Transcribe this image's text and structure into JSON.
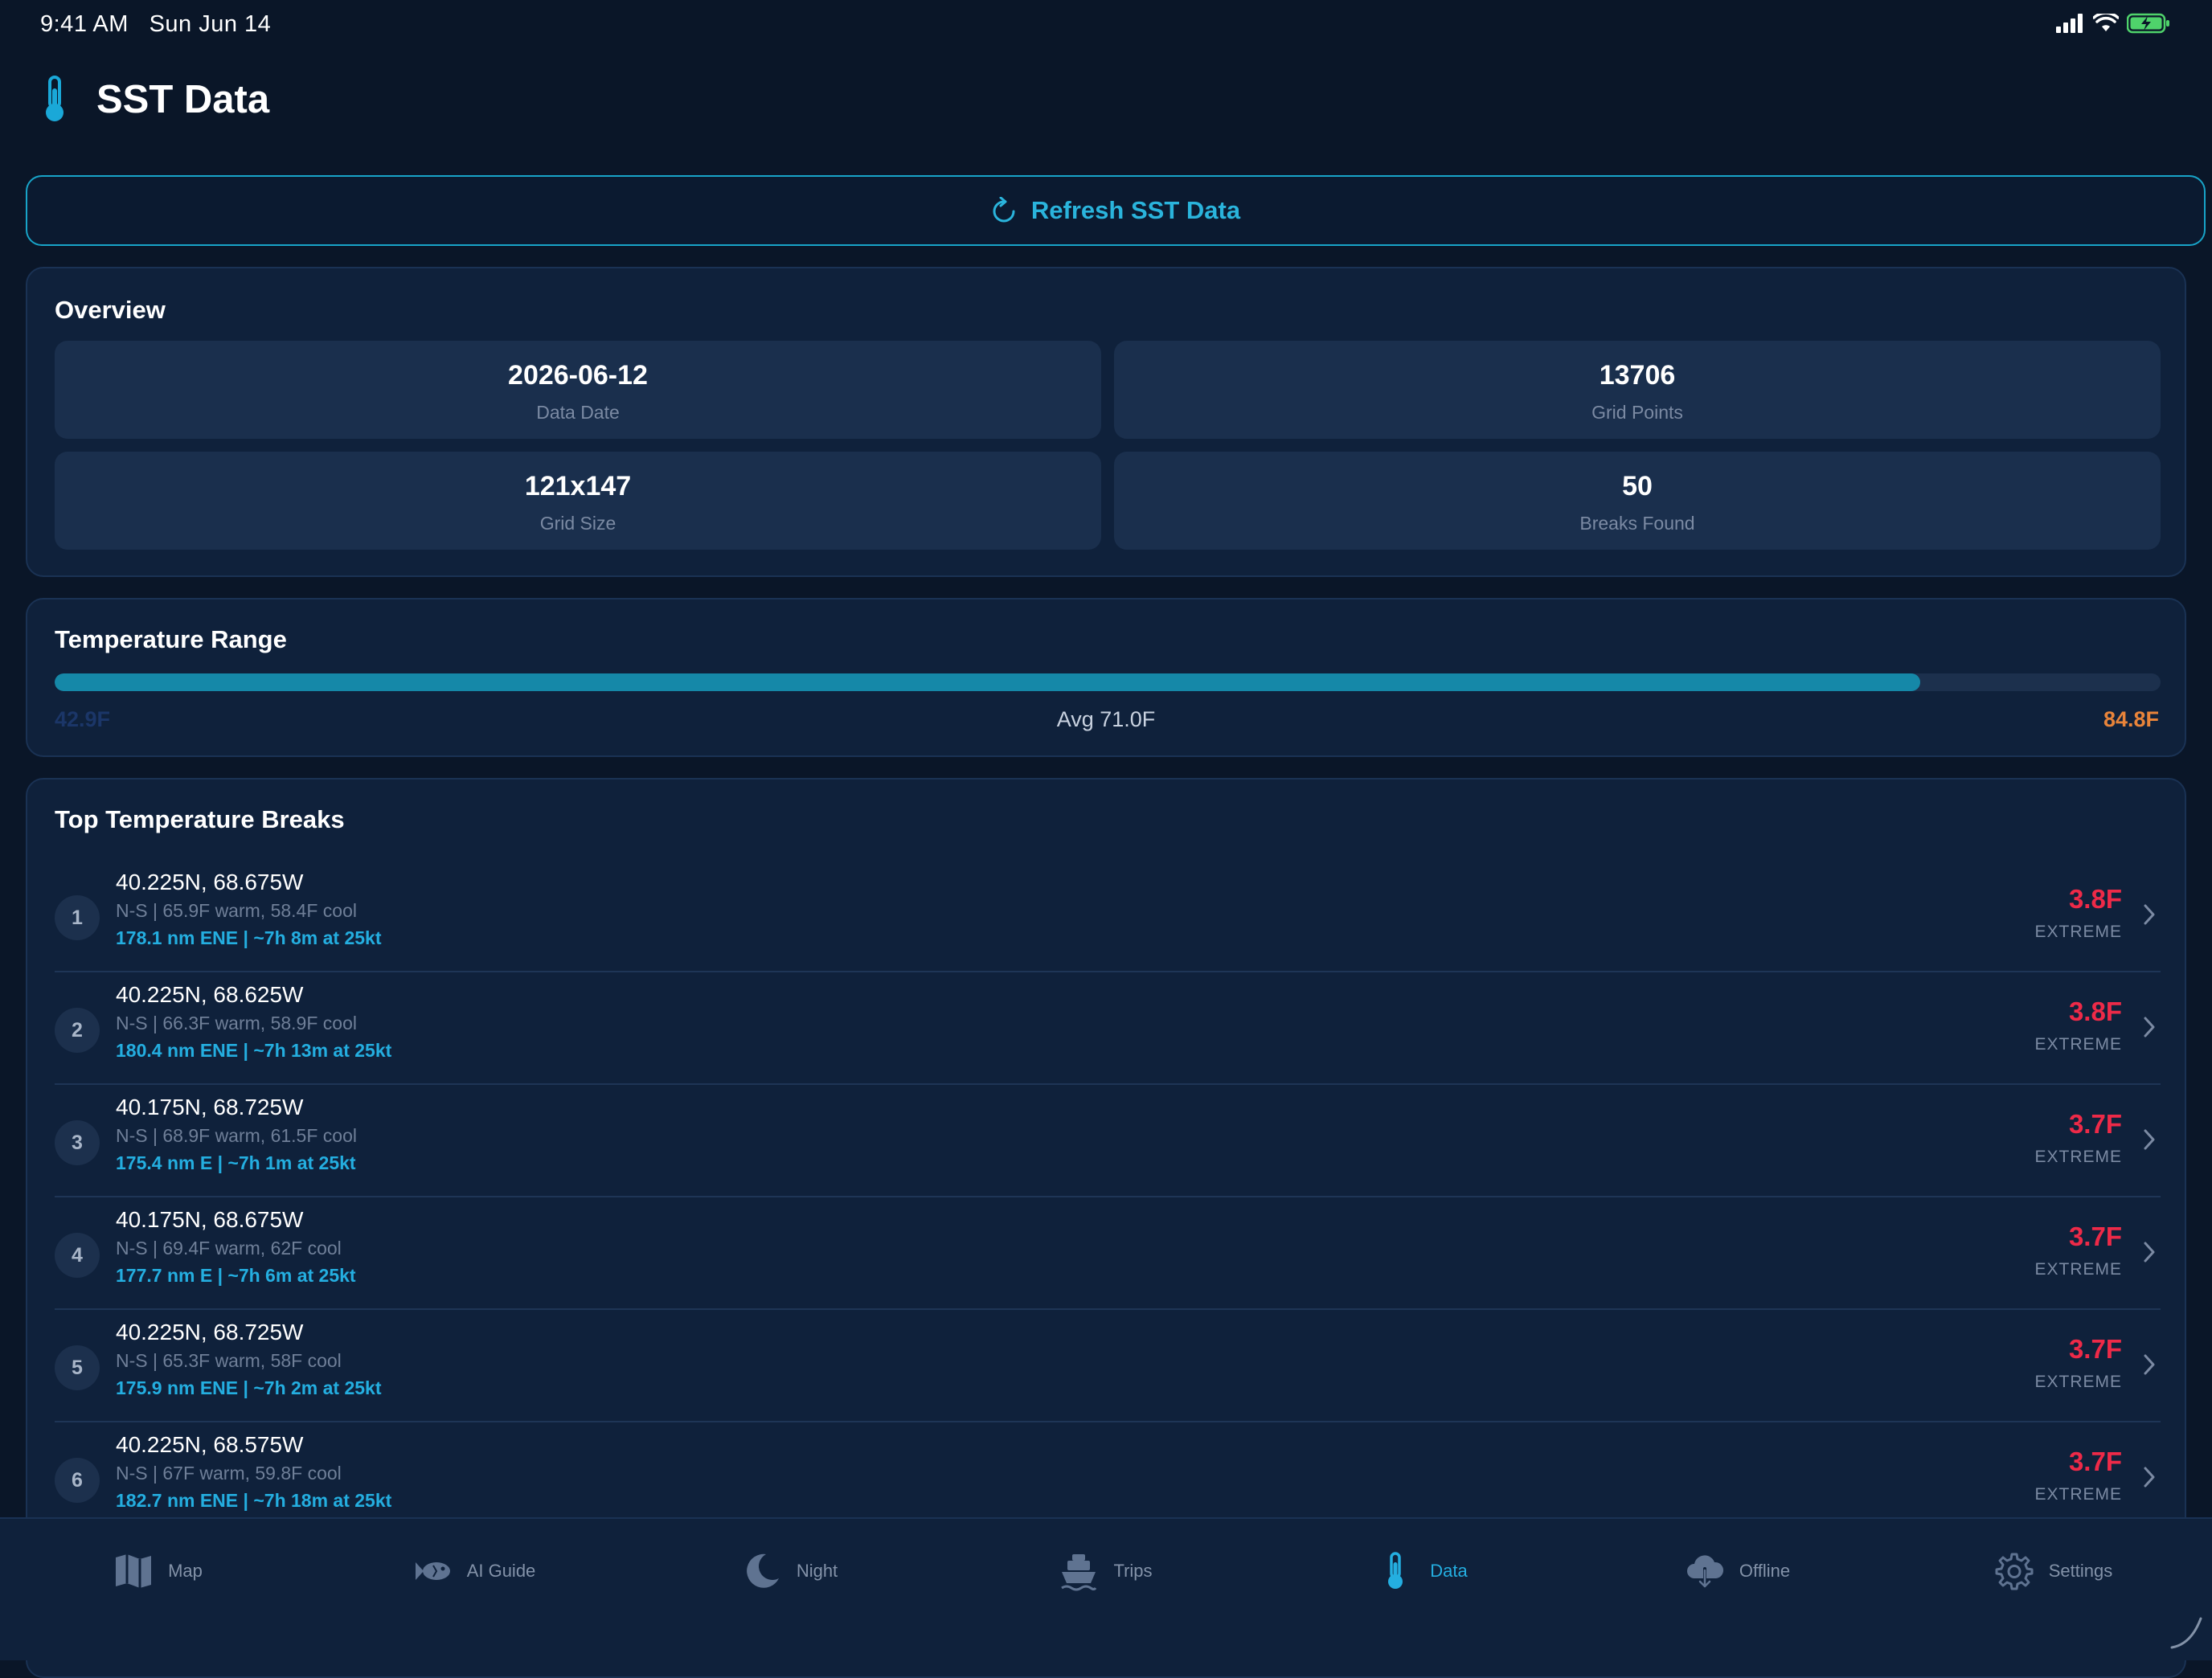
{
  "status_bar": {
    "time": "9:41 AM",
    "date": "Sun Jun 14",
    "icons": [
      "cellular-icon",
      "wifi-icon",
      "battery-charging-icon"
    ]
  },
  "header": {
    "title": "SST Data",
    "icon": "thermometer-icon"
  },
  "refresh": {
    "label": "Refresh SST Data",
    "icon": "refresh-icon"
  },
  "overview": {
    "title": "Overview",
    "stats": [
      {
        "value": "2026-06-12",
        "label": "Data Date"
      },
      {
        "value": "13706",
        "label": "Grid Points"
      },
      {
        "value": "121x147",
        "label": "Grid Size"
      },
      {
        "value": "50",
        "label": "Breaks Found"
      }
    ]
  },
  "temperature_range": {
    "title": "Temperature Range",
    "min_label": "42.9F",
    "avg_label": "Avg 71.0F",
    "max_label": "84.8F",
    "fill_fraction": 0.886
  },
  "breaks": {
    "title": "Top Temperature Breaks",
    "items": [
      {
        "rank": "1",
        "coords": "40.225N, 68.675W",
        "detail": "N-S | 65.9F warm, 58.4F cool",
        "eta": "178.1 nm ENE | ~7h 8m at 25kt",
        "delta": "3.8F",
        "severity": "EXTREME"
      },
      {
        "rank": "2",
        "coords": "40.225N, 68.625W",
        "detail": "N-S | 66.3F warm, 58.9F cool",
        "eta": "180.4 nm ENE | ~7h 13m at 25kt",
        "delta": "3.8F",
        "severity": "EXTREME"
      },
      {
        "rank": "3",
        "coords": "40.175N, 68.725W",
        "detail": "N-S | 68.9F warm, 61.5F cool",
        "eta": "175.4 nm E | ~7h 1m at 25kt",
        "delta": "3.7F",
        "severity": "EXTREME"
      },
      {
        "rank": "4",
        "coords": "40.175N, 68.675W",
        "detail": "N-S | 69.4F warm, 62F cool",
        "eta": "177.7 nm E | ~7h 6m at 25kt",
        "delta": "3.7F",
        "severity": "EXTREME"
      },
      {
        "rank": "5",
        "coords": "40.225N, 68.725W",
        "detail": "N-S | 65.3F warm, 58F cool",
        "eta": "175.9 nm ENE | ~7h 2m at 25kt",
        "delta": "3.7F",
        "severity": "EXTREME"
      },
      {
        "rank": "6",
        "coords": "40.225N, 68.575W",
        "detail": "N-S | 67F warm, 59.8F cool",
        "eta": "182.7 nm ENE | ~7h 18m at 25kt",
        "delta": "3.7F",
        "severity": "EXTREME"
      }
    ]
  },
  "tab_bar": {
    "tabs": [
      {
        "label": "Map",
        "icon": "map-icon",
        "active": false
      },
      {
        "label": "AI Guide",
        "icon": "fish-icon",
        "active": false
      },
      {
        "label": "Night",
        "icon": "moon-icon",
        "active": false
      },
      {
        "label": "Trips",
        "icon": "boat-icon",
        "active": false
      },
      {
        "label": "Data",
        "icon": "thermometer-icon",
        "active": true
      },
      {
        "label": "Offline",
        "icon": "cloud-download-icon",
        "active": false
      },
      {
        "label": "Settings",
        "icon": "gear-icon",
        "active": false
      }
    ]
  },
  "colors": {
    "background": "#0a1628",
    "card": "#0f213b",
    "accent": "#24aee0",
    "extreme": "#ee2a48",
    "max_temp": "#e8843a"
  }
}
